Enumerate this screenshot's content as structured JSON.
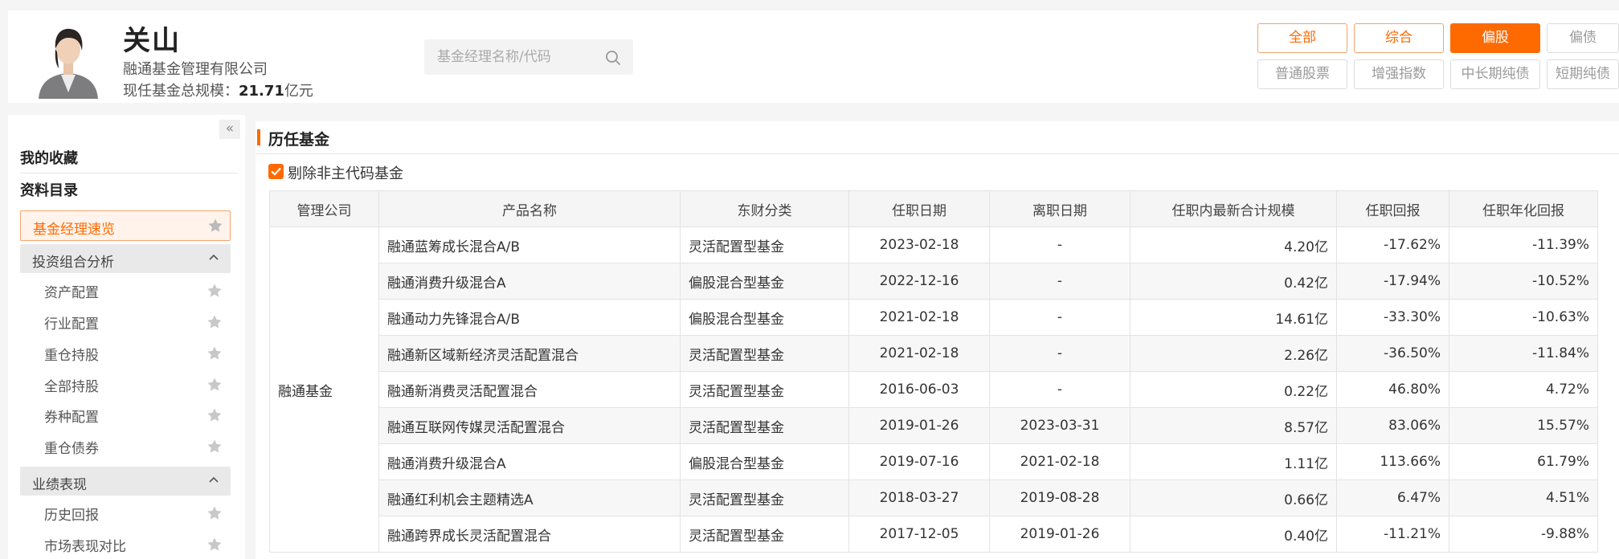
{
  "manager": {
    "name": "关山",
    "company": "融通基金管理有限公司",
    "scale_label": "现任基金总规模：",
    "scale_value": "21.71",
    "scale_unit": "亿元"
  },
  "search": {
    "placeholder": "基金经理名称/代码"
  },
  "filters": {
    "row1": [
      "全部",
      "综合",
      "偏股",
      "偏债"
    ],
    "row2": [
      "普通股票",
      "增强指数",
      "中长期纯债",
      "短期纯债"
    ],
    "active": "偏股"
  },
  "sidebar": {
    "favorites": "我的收藏",
    "directory": "资料目录",
    "active_item": "基金经理速览",
    "group1": {
      "label": "投资组合分析",
      "items": [
        "资产配置",
        "行业配置",
        "重仓持股",
        "全部持股",
        "券种配置",
        "重仓债券"
      ]
    },
    "group2": {
      "label": "业绩表现",
      "items": [
        "历史回报",
        "市场表现对比"
      ]
    }
  },
  "main": {
    "title": "历任基金",
    "checkbox_label": "剔除非主代码基金",
    "columns": [
      "管理公司",
      "产品名称",
      "东财分类",
      "任职日期",
      "离职日期",
      "任职内最新合计规模",
      "任职回报",
      "任职年化回报"
    ],
    "company": "融通基金",
    "rows": [
      {
        "name": "融通蓝筹成长混合A/B",
        "category": "灵活配置型基金",
        "start": "2023-02-18",
        "end": "-",
        "scale": "4.20亿",
        "ret": "-17.62%",
        "ann": "-11.39%"
      },
      {
        "name": "融通消费升级混合A",
        "category": "偏股混合型基金",
        "start": "2022-12-16",
        "end": "-",
        "scale": "0.42亿",
        "ret": "-17.94%",
        "ann": "-10.52%"
      },
      {
        "name": "融通动力先锋混合A/B",
        "category": "偏股混合型基金",
        "start": "2021-02-18",
        "end": "-",
        "scale": "14.61亿",
        "ret": "-33.30%",
        "ann": "-10.63%"
      },
      {
        "name": "融通新区域新经济灵活配置混合",
        "category": "灵活配置型基金",
        "start": "2021-02-18",
        "end": "-",
        "scale": "2.26亿",
        "ret": "-36.50%",
        "ann": "-11.84%"
      },
      {
        "name": "融通新消费灵活配置混合",
        "category": "灵活配置型基金",
        "start": "2016-06-03",
        "end": "-",
        "scale": "0.22亿",
        "ret": "46.80%",
        "ann": "4.72%"
      },
      {
        "name": "融通互联网传媒灵活配置混合",
        "category": "灵活配置型基金",
        "start": "2019-01-26",
        "end": "2023-03-31",
        "scale": "8.57亿",
        "ret": "83.06%",
        "ann": "15.57%"
      },
      {
        "name": "融通消费升级混合A",
        "category": "偏股混合型基金",
        "start": "2019-07-16",
        "end": "2021-02-18",
        "scale": "1.11亿",
        "ret": "113.66%",
        "ann": "61.79%"
      },
      {
        "name": "融通红利机会主题精选A",
        "category": "灵活配置型基金",
        "start": "2018-03-27",
        "end": "2019-08-28",
        "scale": "0.66亿",
        "ret": "6.47%",
        "ann": "4.51%"
      },
      {
        "name": "融通跨界成长灵活配置混合",
        "category": "灵活配置型基金",
        "start": "2017-12-05",
        "end": "2019-01-26",
        "scale": "0.40亿",
        "ret": "-11.21%",
        "ann": "-9.88%"
      }
    ]
  },
  "colors": {
    "accent": "#ff6a00",
    "positive": "#e84040",
    "negative": "#1a9b3a",
    "link": "#1f4fa0"
  }
}
